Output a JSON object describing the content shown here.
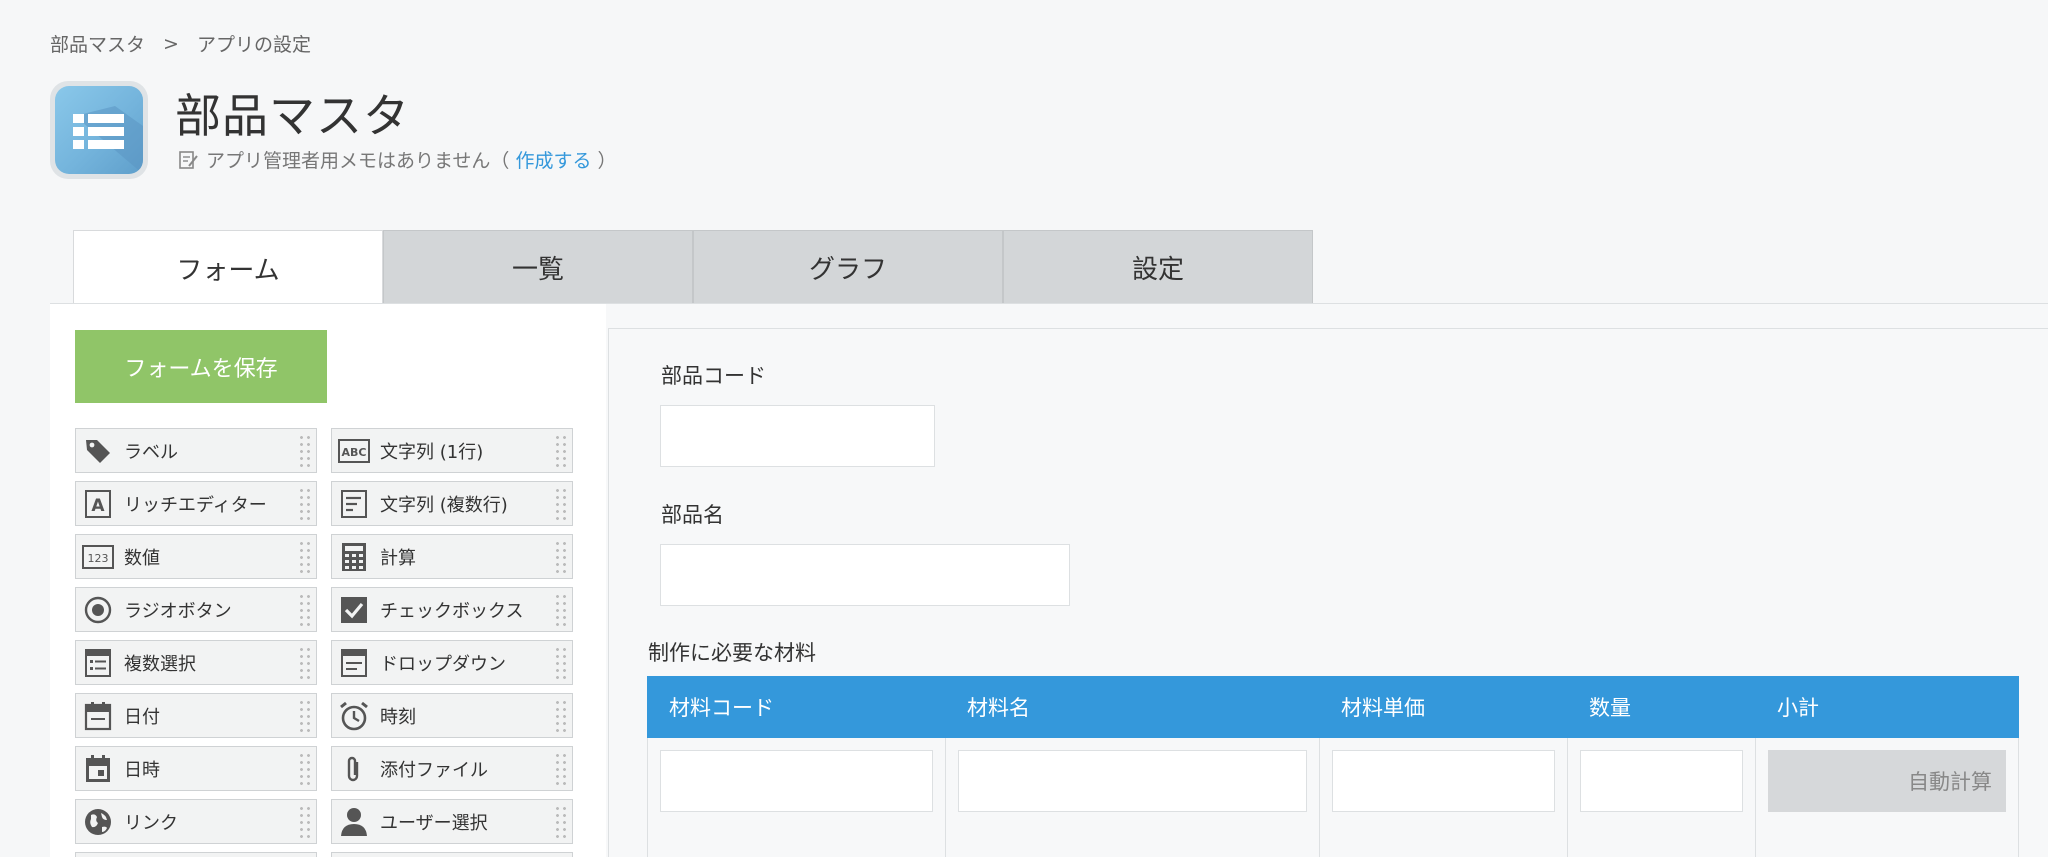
{
  "breadcrumb": {
    "root": "部品マスタ",
    "separator": ">",
    "current": "アプリの設定"
  },
  "app": {
    "title": "部品マスタ",
    "memo_text": "アプリ管理者用メモはありません（",
    "memo_link": "作成する",
    "memo_close": "）"
  },
  "tabs": [
    {
      "label": "フォーム",
      "active": true
    },
    {
      "label": "一覧",
      "active": false
    },
    {
      "label": "グラフ",
      "active": false
    },
    {
      "label": "設定",
      "active": false
    }
  ],
  "save_button": "フォームを保存",
  "palette": [
    {
      "label": "ラベル",
      "icon": "tag-icon"
    },
    {
      "label": "文字列 (1行)",
      "icon": "abc-icon"
    },
    {
      "label": "リッチエディター",
      "icon": "rich-editor-icon"
    },
    {
      "label": "文字列 (複数行)",
      "icon": "multiline-icon"
    },
    {
      "label": "数値",
      "icon": "number-icon"
    },
    {
      "label": "計算",
      "icon": "calculator-icon"
    },
    {
      "label": "ラジオボタン",
      "icon": "radio-icon"
    },
    {
      "label": "チェックボックス",
      "icon": "checkbox-icon"
    },
    {
      "label": "複数選択",
      "icon": "multi-select-icon"
    },
    {
      "label": "ドロップダウン",
      "icon": "dropdown-icon"
    },
    {
      "label": "日付",
      "icon": "date-icon"
    },
    {
      "label": "時刻",
      "icon": "clock-icon"
    },
    {
      "label": "日時",
      "icon": "datetime-icon"
    },
    {
      "label": "添付ファイル",
      "icon": "paperclip-icon"
    },
    {
      "label": "リンク",
      "icon": "globe-icon"
    },
    {
      "label": "ユーザー選択",
      "icon": "user-icon"
    }
  ],
  "form": {
    "field1_label": "部品コード",
    "field2_label": "部品名",
    "table_label": "制作に必要な材料",
    "table_columns": [
      "材料コード",
      "材料名",
      "材料単価",
      "数量",
      "小計"
    ],
    "auto_calc": "自動計算"
  },
  "colors": {
    "accent": "#3498db",
    "save": "#90c568",
    "tab_inactive": "#d3d6d8"
  }
}
